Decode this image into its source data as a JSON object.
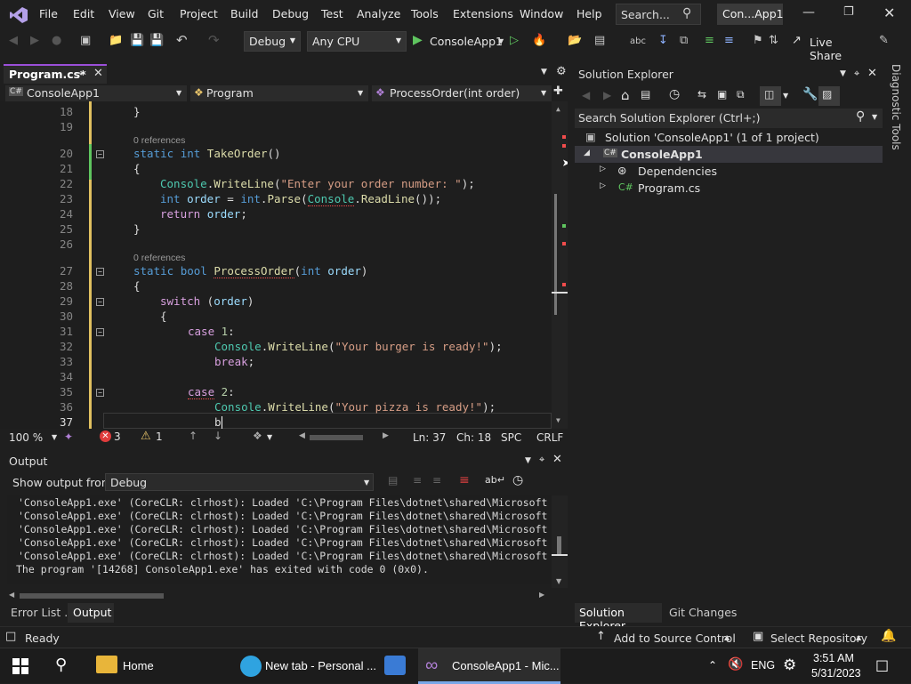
{
  "menubar": {
    "items": [
      "File",
      "Edit",
      "View",
      "Git",
      "Project",
      "Build",
      "Debug",
      "Test",
      "Analyze",
      "Tools",
      "Extensions",
      "Window",
      "Help"
    ],
    "search_label": "Search...",
    "project_badge": "Con...App1"
  },
  "toolbar": {
    "config": "Debug",
    "platform": "Any CPU",
    "run_label": "ConsoleApp1",
    "live_share": "Live Share"
  },
  "editor": {
    "tab_label": "Program.cs*",
    "nav_project": "ConsoleApp1",
    "nav_class": "Program",
    "nav_member": "ProcessOrder(int order)",
    "refs_label": "0 references",
    "line_numbers": [
      "18",
      "19",
      "20",
      "21",
      "22",
      "23",
      "24",
      "25",
      "26",
      "27",
      "28",
      "29",
      "30",
      "31",
      "32",
      "33",
      "34",
      "35",
      "36",
      "37"
    ],
    "zoom": "100 %",
    "errors": "3",
    "warnings": "1",
    "ln": "Ln: 37",
    "ch": "Ch: 18",
    "spc": "SPC",
    "crlf": "CRLF"
  },
  "code": {
    "l18": "}",
    "l20a": "static",
    "l20b": "int",
    "l20c": "TakeOrder",
    "l20d": "()",
    "l21": "{",
    "l22a": "Console",
    "l22b": ".",
    "l22c": "WriteLine",
    "l22d": "(",
    "l22e": "\"Enter your order number: \"",
    "l22f": ");",
    "l23a": "int",
    "l23b": "order",
    "l23c": " = ",
    "l23d": "int",
    "l23e": ".",
    "l23f": "Parse",
    "l23g": "(",
    "l23h": "Console",
    "l23i": ".",
    "l23j": "ReadLine",
    "l23k": "());",
    "l24a": "return",
    "l24b": "order",
    "l24c": ";",
    "l25": "}",
    "l27a": "static",
    "l27b": "bool",
    "l27c": "ProcessOrder",
    "l27d": "(",
    "l27e": "int",
    "l27f": "order",
    "l27g": ")",
    "l28": "{",
    "l29a": "switch",
    "l29b": " (",
    "l29c": "order",
    "l29d": ")",
    "l30": "{",
    "l31a": "case",
    "l31b": "1",
    "l31c": ":",
    "l32a": "Console",
    "l32b": ".",
    "l32c": "WriteLine",
    "l32d": "(",
    "l32e": "\"Your burger is ready!\"",
    "l32f": ");",
    "l33a": "break",
    "l33b": ";",
    "l35a": "case",
    "l35b": "2",
    "l35c": ":",
    "l36a": "Console",
    "l36b": ".",
    "l36c": "WriteLine",
    "l36d": "(",
    "l36e": "\"Your pizza is ready!\"",
    "l36f": ");",
    "l37": "b"
  },
  "output": {
    "title": "Output",
    "show_from_label": "Show output from:",
    "source": "Debug",
    "lines": [
      "'ConsoleApp1.exe' (CoreCLR: clrhost): Loaded 'C:\\Program Files\\dotnet\\shared\\Microsoft",
      "'ConsoleApp1.exe' (CoreCLR: clrhost): Loaded 'C:\\Program Files\\dotnet\\shared\\Microsoft",
      "'ConsoleApp1.exe' (CoreCLR: clrhost): Loaded 'C:\\Program Files\\dotnet\\shared\\Microsoft",
      "'ConsoleApp1.exe' (CoreCLR: clrhost): Loaded 'C:\\Program Files\\dotnet\\shared\\Microsoft",
      "'ConsoleApp1.exe' (CoreCLR: clrhost): Loaded 'C:\\Program Files\\dotnet\\shared\\Microsoft",
      "The program '[14268] ConsoleApp1.exe' has exited with code 0 (0x0)."
    ]
  },
  "bottom_tabs": [
    "Error List ...",
    "Output"
  ],
  "solution": {
    "title": "Solution Explorer",
    "search_placeholder": "Search Solution Explorer (Ctrl+;)",
    "solution_label": "Solution 'ConsoleApp1' (1 of 1 project)",
    "project_label": "ConsoleApp1",
    "dependencies_label": "Dependencies",
    "file_label": "Program.cs",
    "tabs": [
      "Solution Explorer",
      "Git Changes"
    ]
  },
  "diag_label": "Diagnostic Tools",
  "statusbar": {
    "ready": "Ready",
    "source_control": "Add to Source Control",
    "repository": "Select Repository"
  },
  "taskbar": {
    "home": "Home",
    "edge": "New tab - Personal ...",
    "vs": "ConsoleApp1 - Mic...",
    "lang": "ENG",
    "time": "3:51 AM",
    "date": "5/31/2023"
  },
  "colors": {
    "accent": "#9b4fd9",
    "keyword": "#569cd6",
    "type": "#4ec9b0",
    "method": "#dcdcaa",
    "string": "#d69d85",
    "error": "#f14c4c"
  }
}
